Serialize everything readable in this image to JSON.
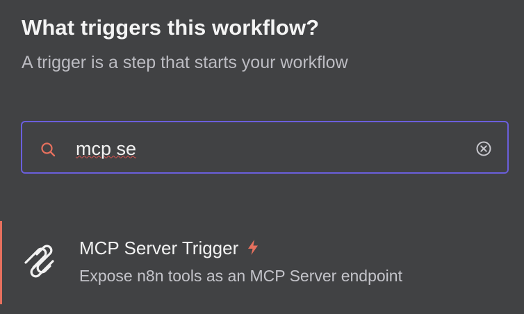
{
  "header": {
    "title": "What triggers this workflow?",
    "subtitle": "A trigger is a step that starts your workflow"
  },
  "search": {
    "value": "mcp se",
    "icon": "search-icon",
    "clear_icon": "clear-icon"
  },
  "results": [
    {
      "name": "MCP Server Trigger",
      "description": "Expose n8n tools as an MCP Server endpoint",
      "icon": "mcp-icon",
      "badge_icon": "bolt-icon"
    }
  ],
  "colors": {
    "background": "#414244",
    "search_border": "#6a5fdc",
    "accent": "#e6705e",
    "title": "#f4f4f4",
    "subtitle": "#bcbcc2"
  }
}
